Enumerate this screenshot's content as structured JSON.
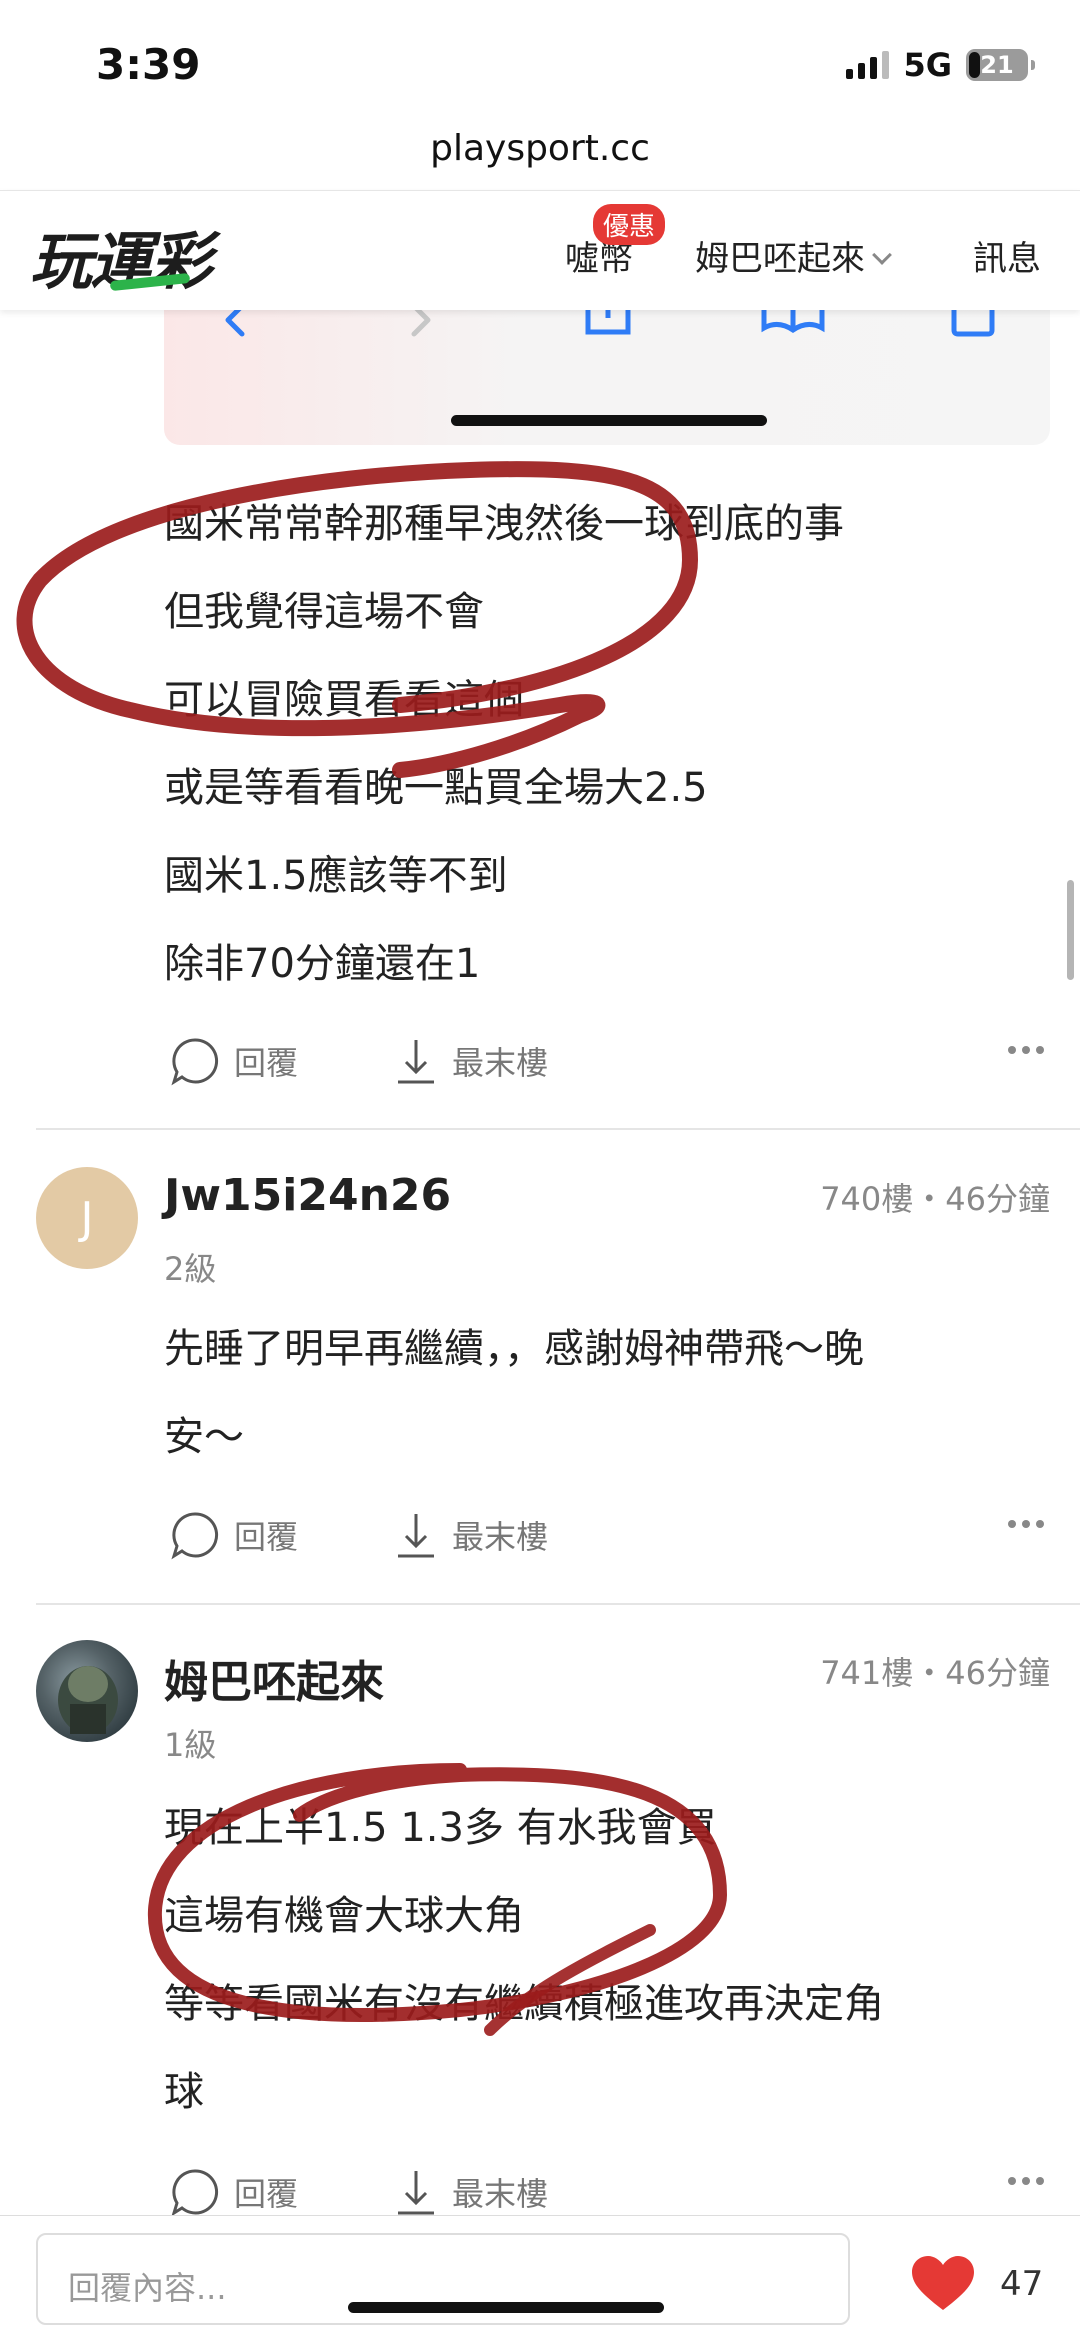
{
  "status_bar": {
    "time": "3:39",
    "network": "5G",
    "battery": "21"
  },
  "browser": {
    "url": "playsport.cc"
  },
  "header": {
    "logo_text": "玩運彩",
    "coins_label": "噓幣",
    "badge_label": "優惠",
    "user_label": "姆巴呸起來",
    "messages_label": "訊息"
  },
  "first_post": {
    "lines": [
      "國米常常幹那種早洩然後一球到底的事",
      "但我覺得這場不會",
      "可以冒險買看看這個",
      "或是等看看晚一點買全場大2.5",
      "國米1.5應該等不到",
      "除非70分鐘還在1"
    ],
    "reply_label": "回覆",
    "last_floor_label": "最末樓"
  },
  "posts": [
    {
      "avatar_letter": "J",
      "username": "Jw15i24n26",
      "level": "2級",
      "meta": "740樓・46分鐘",
      "lines": [
        "先睡了明早再繼續，，感謝姆神帶飛～晚",
        "安～"
      ],
      "reply_label": "回覆",
      "last_floor_label": "最末樓"
    },
    {
      "username": "姆巴呸起來",
      "level": "1級",
      "meta": "741樓・46分鐘",
      "lines": [
        "現在上半1.5 1.3多 有水我會買",
        "這場有機會大球大角",
        "等等看國米有沒有繼續積極進攻再決定角",
        "球"
      ],
      "reply_label": "回覆",
      "last_floor_label": "最末樓"
    }
  ],
  "reply_bar": {
    "placeholder": "回覆內容...",
    "likes": "47"
  },
  "colors": {
    "accent_red": "#e53935",
    "logo_green": "#2cb34a",
    "annotation": "#9b1c1c",
    "ios_blue": "#2f7cf6"
  }
}
